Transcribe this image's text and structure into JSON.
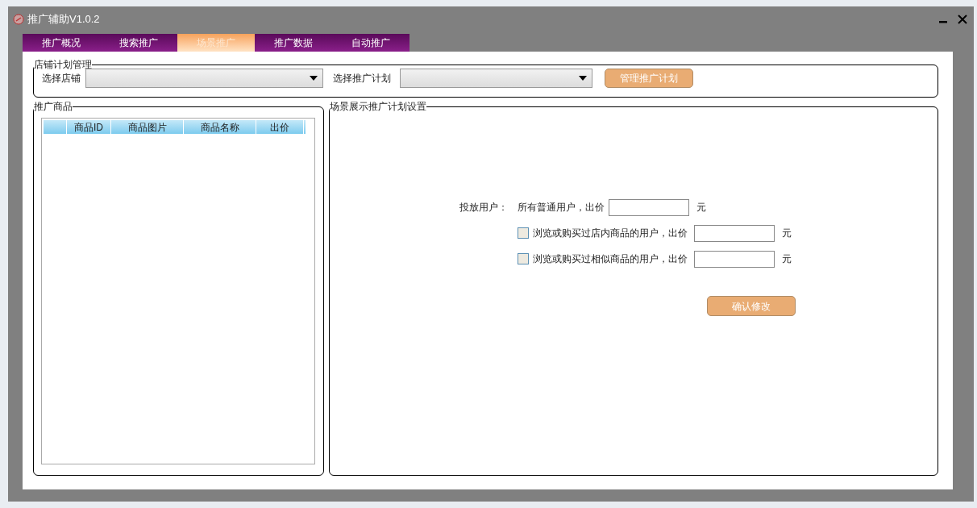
{
  "window": {
    "title": "推广辅助V1.0.2"
  },
  "tabs": [
    {
      "label": "推广概况",
      "selected": false
    },
    {
      "label": "搜索推广",
      "selected": false
    },
    {
      "label": "场景推广",
      "selected": true
    },
    {
      "label": "推广数据",
      "selected": false
    },
    {
      "label": "自动推广",
      "selected": false
    }
  ],
  "shop_plan_group": {
    "legend": "店铺计划管理",
    "shop_label": "选择店铺",
    "plan_label": "选择推广计划",
    "manage_button": "管理推广计划"
  },
  "products_group": {
    "legend": "推广商品",
    "table": {
      "columns": [
        "商品ID",
        "商品图片",
        "商品名称",
        "出价"
      ]
    }
  },
  "scene_group": {
    "legend": "场景展示推广计划设置",
    "target_label": "投放用户：",
    "options": [
      {
        "kind": "plain",
        "label": "所有普通用户，出价",
        "unit": "元"
      },
      {
        "kind": "checkbox",
        "checked": false,
        "label": "浏览或购买过店内商品的用户，出价",
        "unit": "元"
      },
      {
        "kind": "checkbox",
        "checked": false,
        "label": "浏览或购买过相似商品的用户，出价",
        "unit": "元"
      }
    ],
    "confirm_button": "确认修改"
  }
}
